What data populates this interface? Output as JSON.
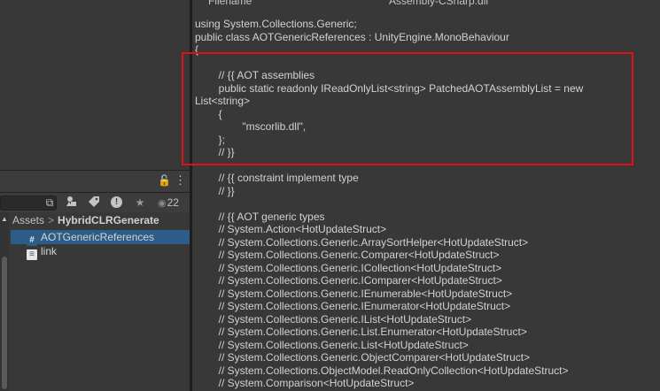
{
  "code_header": {
    "col1": "Filename",
    "col2": "Assembly-CSharp.dll"
  },
  "code_lines": [
    "using System.Collections.Generic;",
    "public class AOTGenericReferences : UnityEngine.MonoBehaviour",
    "{",
    "",
    "\t// {{ AOT assemblies",
    "\tpublic static readonly IReadOnlyList<string> PatchedAOTAssemblyList = new",
    "List<string>",
    "\t{",
    "\t\t\"mscorlib.dll\",",
    "\t};",
    "\t// }}",
    "",
    "\t// {{ constraint implement type",
    "\t// }}",
    "",
    "\t// {{ AOT generic types",
    "\t// System.Action<HotUpdateStruct>",
    "\t// System.Collections.Generic.ArraySortHelper<HotUpdateStruct>",
    "\t// System.Collections.Generic.Comparer<HotUpdateStruct>",
    "\t// System.Collections.Generic.ICollection<HotUpdateStruct>",
    "\t// System.Collections.Generic.IComparer<HotUpdateStruct>",
    "\t// System.Collections.Generic.IEnumerable<HotUpdateStruct>",
    "\t// System.Collections.Generic.IEnumerator<HotUpdateStruct>",
    "\t// System.Collections.Generic.IList<HotUpdateStruct>",
    "\t// System.Collections.Generic.List.Enumerator<HotUpdateStruct>",
    "\t// System.Collections.Generic.List<HotUpdateStruct>",
    "\t// System.Collections.Generic.ObjectComparer<HotUpdateStruct>",
    "\t// System.Collections.ObjectModel.ReadOnlyCollection<HotUpdateStruct>",
    "\t// System.Comparison<HotUpdateStruct>"
  ],
  "project_panel": {
    "visible_count": "22",
    "breadcrumb": {
      "root": "Assets",
      "separator": ">",
      "current": "HybridCLRGenerate"
    },
    "files": [
      {
        "name": "AOTGenericReferences",
        "icon": "csharp-script-icon",
        "icon_glyph": "#",
        "selected": true
      },
      {
        "name": "link",
        "icon": "text-file-icon",
        "icon_glyph": "",
        "selected": false
      }
    ]
  },
  "icons": {
    "lock": "🔓",
    "kebab": "⋮",
    "search_by_type": "⧉",
    "filter_by_label": "🏷",
    "favorites": "★",
    "eye": "👁"
  },
  "colors": {
    "selection": "#2c5d87",
    "highlight_border": "#e0101a",
    "panel_bg": "#383838"
  }
}
